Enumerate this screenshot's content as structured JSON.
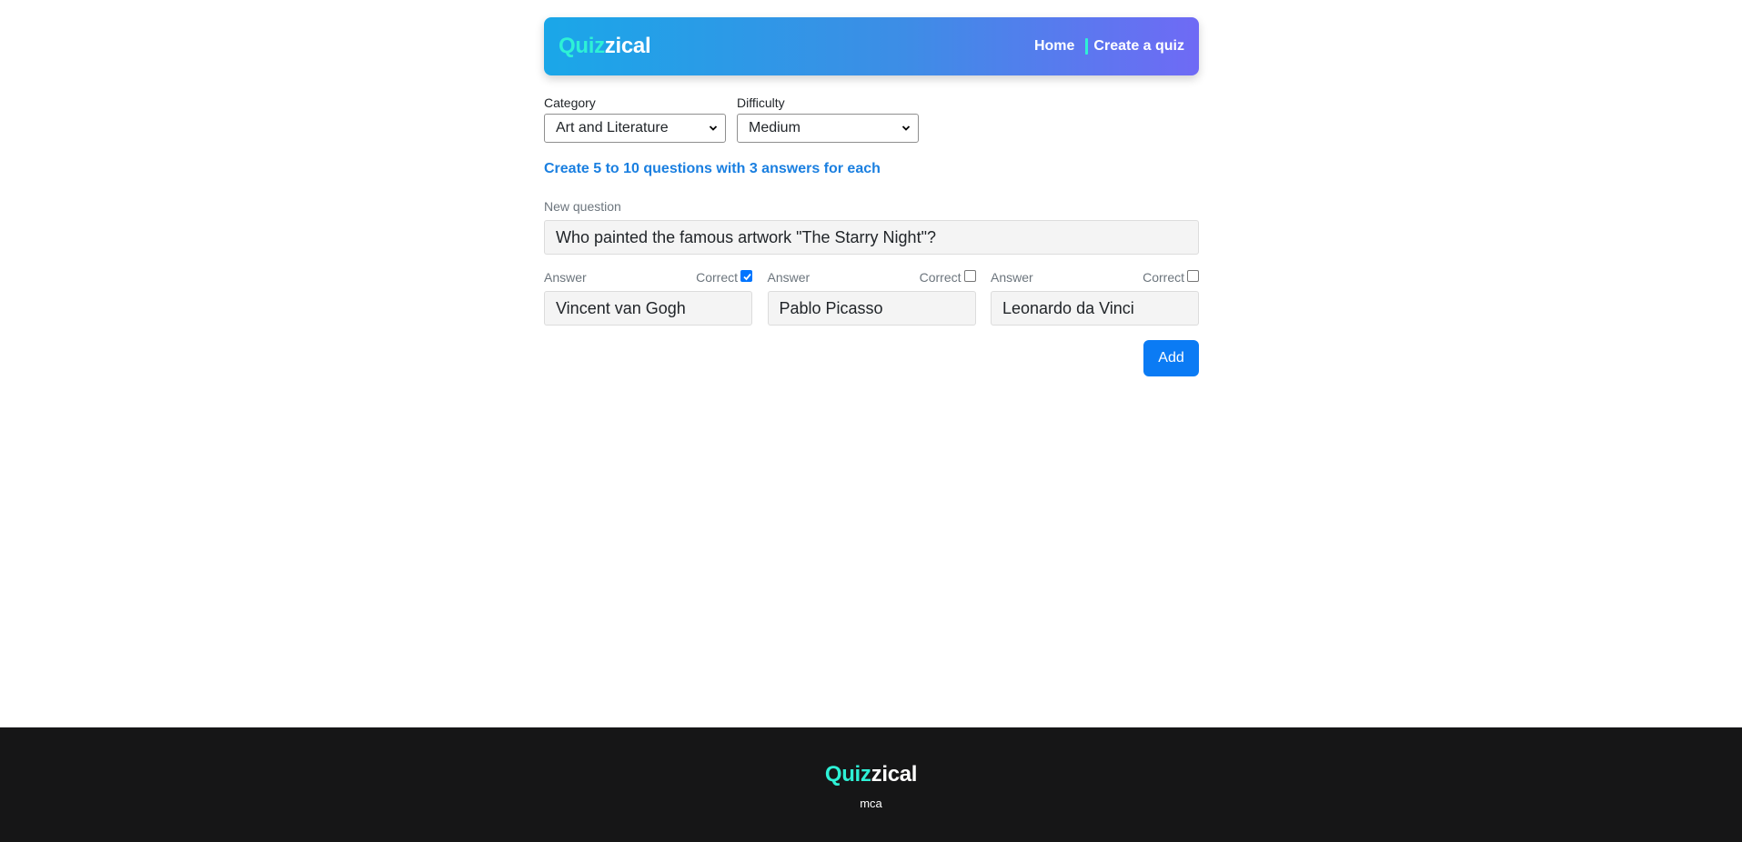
{
  "header": {
    "logo_part1": "Quiz",
    "logo_part2": "zical",
    "nav": {
      "home": "Home",
      "create": "Create a quiz"
    }
  },
  "filters": {
    "category_label": "Category",
    "category_value": "Art and Literature",
    "difficulty_label": "Difficulty",
    "difficulty_value": "Medium"
  },
  "instructions": "Create 5 to 10 questions with 3 answers for each",
  "question": {
    "label": "New question",
    "value": "Who painted the famous artwork \"The Starry Night\"?"
  },
  "answers": [
    {
      "label": "Answer",
      "correct_label": "Correct",
      "value": "Vincent van Gogh",
      "correct": true
    },
    {
      "label": "Answer",
      "correct_label": "Correct",
      "value": "Pablo Picasso",
      "correct": false
    },
    {
      "label": "Answer",
      "correct_label": "Correct",
      "value": "Leonardo da Vinci",
      "correct": false
    }
  ],
  "add_button": "Add",
  "footer": {
    "logo_part1": "Quiz",
    "logo_part2": "zical",
    "sub": "mca"
  },
  "colors": {
    "accent": "#2ef1d6",
    "primary": "#0b7bf4",
    "instruction_text": "#1a7fe0",
    "footer_bg": "#161617"
  }
}
